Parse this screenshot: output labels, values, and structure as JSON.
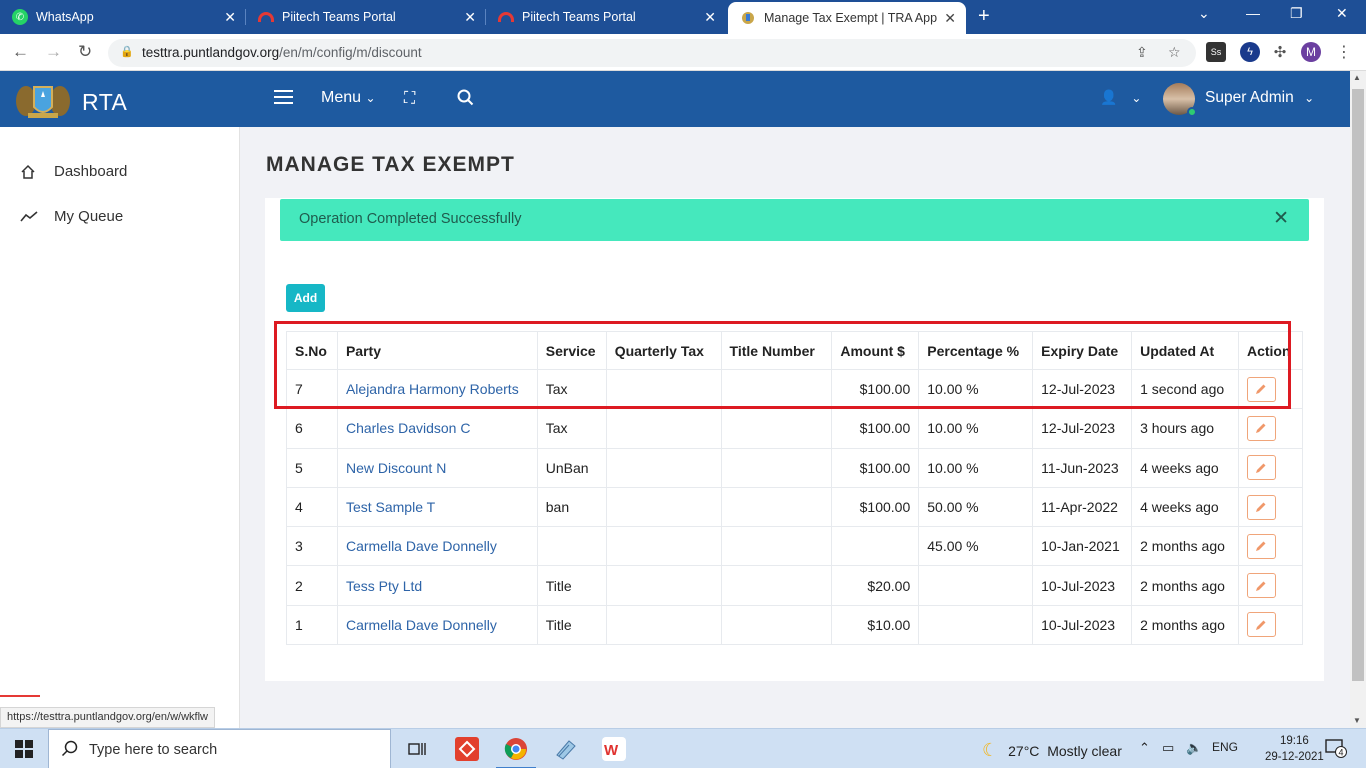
{
  "browser": {
    "tabs": [
      {
        "title": "WhatsApp",
        "icon": "whatsapp-icon"
      },
      {
        "title": "Piitech Teams Portal",
        "icon": "portal-icon"
      },
      {
        "title": "Piitech Teams Portal",
        "icon": "portal-icon"
      },
      {
        "title": "Manage Tax Exempt | TRA App",
        "icon": "rta-emblem-icon",
        "active": true
      }
    ],
    "url_host": "testtra.puntlandgov.org",
    "url_path": "/en/m/config/m/discount",
    "extension_avatar": "M",
    "extension_ss": "Ss"
  },
  "header": {
    "brand": "RTA",
    "menu_label": "Menu",
    "user_name": "Super Admin"
  },
  "sidebar": {
    "items": [
      {
        "label": "Dashboard",
        "icon": "home-icon"
      },
      {
        "label": "My Queue",
        "icon": "trend-line-icon"
      }
    ]
  },
  "page": {
    "title": "MANAGE TAX EXEMPT",
    "alert": "Operation Completed Successfully",
    "add_label": "Add"
  },
  "table": {
    "columns": [
      "S.No",
      "Party",
      "Service",
      "Quarterly Tax",
      "Title Number",
      "Amount $",
      "Percentage %",
      "Expiry Date",
      "Updated At",
      "Action"
    ],
    "rows": [
      {
        "sno": "7",
        "party": "Alejandra Harmony Roberts",
        "service": "Tax",
        "quarterly": "",
        "title_no": "",
        "amount": "$100.00",
        "percentage": "10.00 %",
        "expiry": "12-Jul-2023",
        "updated": "1 second ago"
      },
      {
        "sno": "6",
        "party": "Charles Davidson C",
        "service": "Tax",
        "quarterly": "",
        "title_no": "",
        "amount": "$100.00",
        "percentage": "10.00 %",
        "expiry": "12-Jul-2023",
        "updated": "3 hours ago"
      },
      {
        "sno": "5",
        "party": "New Discount N",
        "service": "UnBan",
        "quarterly": "",
        "title_no": "",
        "amount": "$100.00",
        "percentage": "10.00 %",
        "expiry": "11-Jun-2023",
        "updated": "4 weeks ago"
      },
      {
        "sno": "4",
        "party": "Test Sample T",
        "service": "ban",
        "quarterly": "",
        "title_no": "",
        "amount": "$100.00",
        "percentage": "50.00 %",
        "expiry": "11-Apr-2022",
        "updated": "4 weeks ago"
      },
      {
        "sno": "3",
        "party": "Carmella Dave Donnelly",
        "service": "",
        "quarterly": "",
        "title_no": "",
        "amount": "",
        "percentage": "45.00 %",
        "expiry": "10-Jan-2021",
        "updated": "2 months ago"
      },
      {
        "sno": "2",
        "party": "Tess Pty Ltd",
        "service": "Title",
        "quarterly": "",
        "title_no": "",
        "amount": "$20.00",
        "percentage": "",
        "expiry": "10-Jul-2023",
        "updated": "2 months ago"
      },
      {
        "sno": "1",
        "party": "Carmella Dave Donnelly",
        "service": "Title",
        "quarterly": "",
        "title_no": "",
        "amount": "$10.00",
        "percentage": "",
        "expiry": "10-Jul-2023",
        "updated": "2 months ago"
      }
    ]
  },
  "status_bar_url": "https://testtra.puntlandgov.org/en/w/wkflw",
  "taskbar": {
    "search_placeholder": "Type here to search",
    "weather": "27°C  Mostly clear",
    "language": "ENG",
    "time": "19:16",
    "date": "29-12-2021",
    "notifications": "4"
  },
  "colors": {
    "header": "#1e5aa0",
    "tabbar": "#1e4f96",
    "alert": "#45e8bd",
    "add_button": "#16b7c6",
    "link": "#2e64a8",
    "highlight": "#dd1a22"
  }
}
